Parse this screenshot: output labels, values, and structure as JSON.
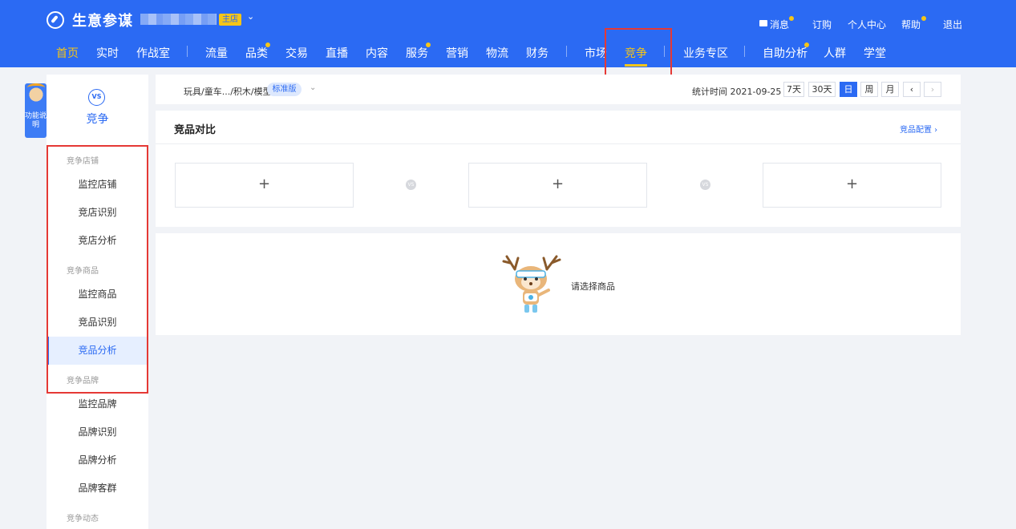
{
  "header": {
    "brand": "生意参谋",
    "shop_badge": "主店",
    "right_links": [
      {
        "label": "消息",
        "has_dot": true
      },
      {
        "label": "订购",
        "has_dot": false
      },
      {
        "label": "个人中心",
        "has_dot": false
      },
      {
        "label": "帮助",
        "has_dot": true
      },
      {
        "label": "退出",
        "has_dot": false
      }
    ],
    "nav": [
      {
        "label": "首页"
      },
      {
        "label": "实时"
      },
      {
        "label": "作战室"
      },
      {
        "label": "流量"
      },
      {
        "label": "品类"
      },
      {
        "label": "交易"
      },
      {
        "label": "直播"
      },
      {
        "label": "内容"
      },
      {
        "label": "服务"
      },
      {
        "label": "营销"
      },
      {
        "label": "物流"
      },
      {
        "label": "财务"
      },
      {
        "label": "市场"
      },
      {
        "label": "竞争"
      },
      {
        "label": "业务专区"
      },
      {
        "label": "自助分析"
      },
      {
        "label": "人群"
      },
      {
        "label": "学堂"
      }
    ],
    "active_nav": "竞争"
  },
  "func_tip": {
    "label": "功能说明"
  },
  "sidebar": {
    "icon_text": "VS",
    "title": "竞争",
    "groups": [
      {
        "label": "竞争店铺",
        "items": [
          "监控店铺",
          "竞店识别",
          "竞店分析"
        ]
      },
      {
        "label": "竞争商品",
        "items": [
          "监控商品",
          "竞品识别",
          "竞品分析"
        ]
      },
      {
        "label": "竞争品牌",
        "items": [
          "监控品牌",
          "品牌识别",
          "品牌分析",
          "品牌客群"
        ]
      },
      {
        "label": "竞争动态",
        "items": []
      }
    ],
    "active_item": "竞品分析"
  },
  "filter": {
    "category": "玩具/童车.../积木/模型",
    "version_badge": "标准版",
    "stat_time_label": "统计时间 2021-09-25",
    "ranges": [
      "7天",
      "30天",
      "日",
      "周",
      "月"
    ],
    "active_range": "日",
    "prev": "‹",
    "next": "›"
  },
  "compare": {
    "title": "竞品对比",
    "config_link": "竞品配置 ›",
    "slots": [
      "+",
      "+",
      "+"
    ],
    "vs_text": "VS"
  },
  "empty": {
    "message": "请选择商品"
  },
  "colors": {
    "brand_blue": "#2b6af3",
    "highlight_yellow": "#f5c518",
    "annotation_red": "#e53935"
  }
}
